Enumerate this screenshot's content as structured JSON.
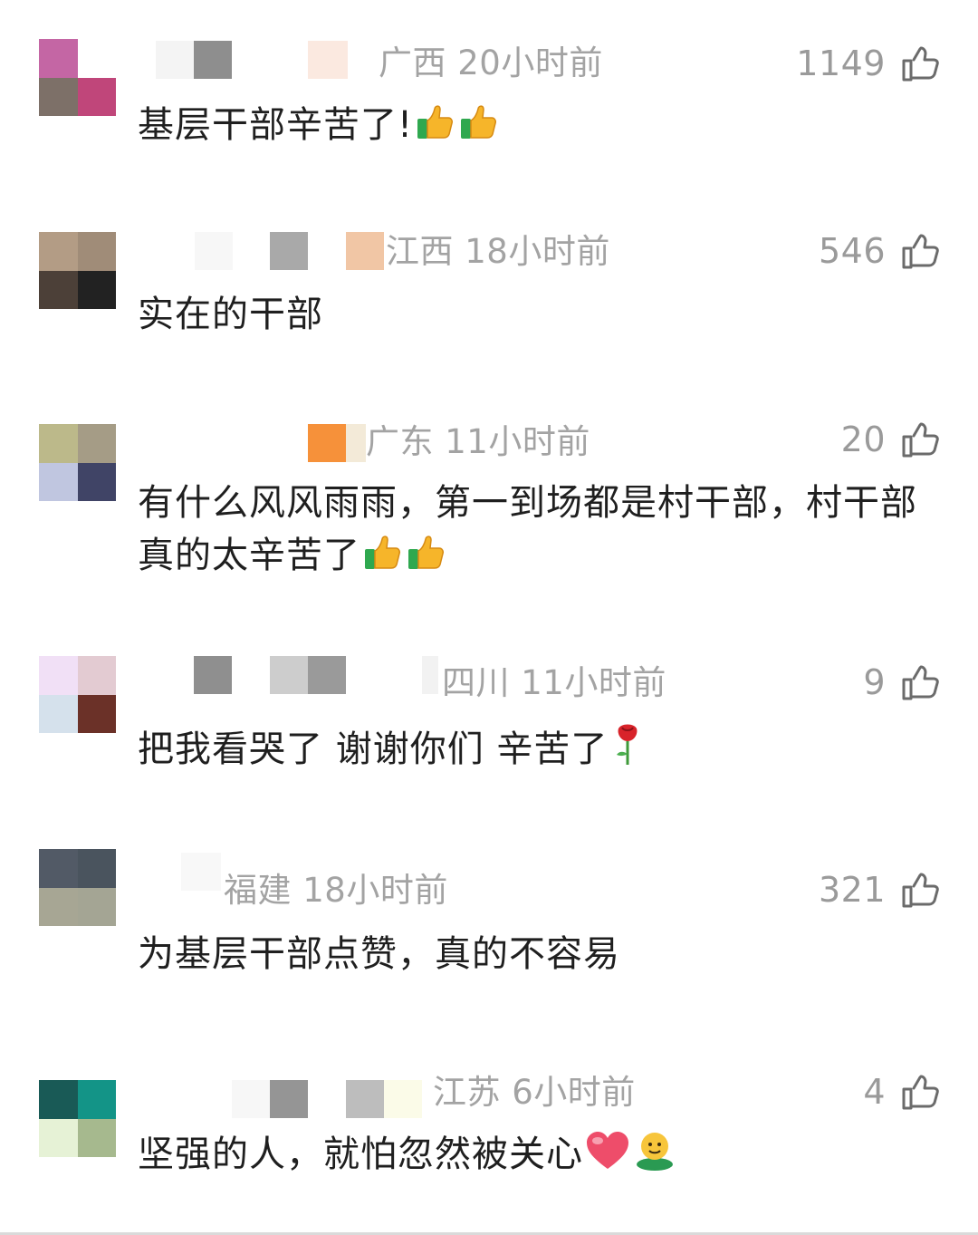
{
  "comments": [
    {
      "avatar": [
        "#c466a4",
        "#ffffff",
        "#7d7068",
        "#c0467a"
      ],
      "location": "广西",
      "time": "20小时前",
      "likes": "1149",
      "text": "基层干部辛苦了!",
      "emojis": [
        "thumbs-up",
        "thumbs-up"
      ]
    },
    {
      "avatar": [
        "#b39c85",
        "#a08c78",
        "#4c4038",
        "#222222"
      ],
      "location": "江西",
      "time": "18小时前",
      "likes": "546",
      "text": "实在的干部",
      "emojis": []
    },
    {
      "avatar": [
        "#bcb98a",
        "#a59c86",
        "#c0c6e0",
        "#404466"
      ],
      "location": "广东",
      "time": "11小时前",
      "likes": "20",
      "text": "有什么风风雨雨，第一到场都是村干部，村干部真的太辛苦了",
      "emojis": [
        "thumbs-up",
        "thumbs-up"
      ]
    },
    {
      "avatar": [
        "#f1e0f6",
        "#e3cbd2",
        "#d5e1ec",
        "#6b3128"
      ],
      "location": "四川",
      "time": "11小时前",
      "likes": "9",
      "text": "把我看哭了 谢谢你们 辛苦了",
      "emojis": [
        "rose"
      ]
    },
    {
      "avatar": [
        "#525a66",
        "#4a545e",
        "#a7a694",
        "#a4a594"
      ],
      "location": "福建",
      "time": "18小时前",
      "likes": "321",
      "text": "为基层干部点赞，真的不容易",
      "emojis": []
    },
    {
      "avatar": [
        "#195a56",
        "#139487",
        "#e6f2d6",
        "#a6b98e"
      ],
      "location": "江苏",
      "time": "6小时前",
      "likes": "4",
      "text": "坚强的人，就怕忽然被关心",
      "emojis": [
        "heart",
        "green-face"
      ]
    }
  ]
}
